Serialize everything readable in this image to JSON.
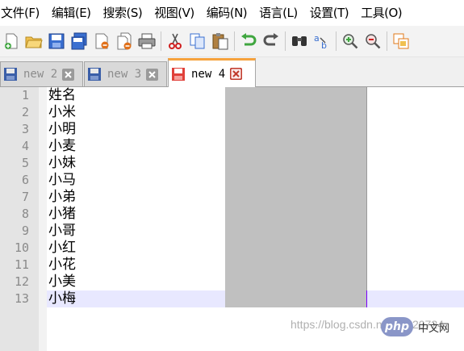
{
  "menu": {
    "items": [
      "文件(F)",
      "编辑(E)",
      "搜索(S)",
      "视图(V)",
      "编码(N)",
      "语言(L)",
      "设置(T)",
      "工具(O)"
    ]
  },
  "toolbar": {
    "icons": [
      "new-file-icon",
      "open-file-icon",
      "save-icon",
      "save-all-icon",
      "close-icon",
      "close-all-icon",
      "print-icon",
      "cut-icon",
      "copy-icon",
      "paste-icon",
      "undo-icon",
      "redo-icon",
      "find-icon",
      "replace-icon",
      "zoom-in-icon",
      "zoom-out-icon",
      "sync-scroll-icon"
    ]
  },
  "tabs": [
    {
      "label": "new 2",
      "active": false
    },
    {
      "label": "new 3",
      "active": false
    },
    {
      "label": "new 4",
      "active": true
    }
  ],
  "editor": {
    "line_numbers": [
      "1",
      "2",
      "3",
      "4",
      "5",
      "6",
      "7",
      "8",
      "9",
      "10",
      "11",
      "12",
      "13"
    ],
    "lines": [
      "姓名",
      "小米",
      "小明",
      "小麦",
      "小妹",
      "小马",
      "小弟",
      "小猪",
      "小哥",
      "小红",
      "小花",
      "小美",
      "小梅"
    ],
    "current_line": 13
  },
  "watermark": {
    "logo": "php",
    "site": "中文网",
    "url": "https://blog.csdn.net/lib920724"
  },
  "colors": {
    "active_tab_accent": "#f6a23d",
    "column_block": "#c0c0c0",
    "current_line_bg": "#e8e8ff",
    "gutter_bg": "#e4e4e4"
  }
}
